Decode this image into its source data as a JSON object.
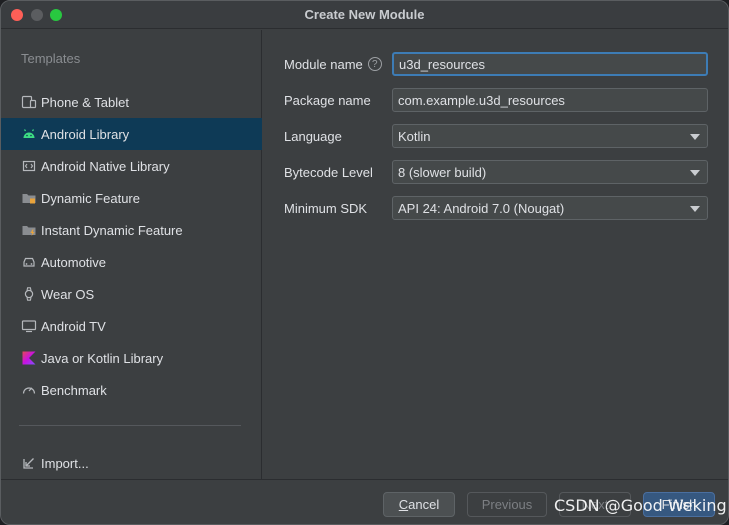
{
  "window": {
    "title": "Create New Module"
  },
  "sidebar": {
    "heading": "Templates",
    "items": [
      {
        "label": "Phone & Tablet",
        "icon": "phone-tablet-icon"
      },
      {
        "label": "Android Library",
        "icon": "android-icon",
        "selected": true
      },
      {
        "label": "Android Native Library",
        "icon": "native-library-icon"
      },
      {
        "label": "Dynamic Feature",
        "icon": "dynamic-feature-folder-icon"
      },
      {
        "label": "Instant Dynamic Feature",
        "icon": "instant-feature-folder-icon"
      },
      {
        "label": "Automotive",
        "icon": "car-icon"
      },
      {
        "label": "Wear OS",
        "icon": "watch-icon"
      },
      {
        "label": "Android TV",
        "icon": "tv-icon"
      },
      {
        "label": "Java or Kotlin Library",
        "icon": "kotlin-icon"
      },
      {
        "label": "Benchmark",
        "icon": "gauge-icon"
      }
    ],
    "import_label": "Import..."
  },
  "form": {
    "module_name": {
      "label": "Module name",
      "value": "u3d_resources",
      "help": "?"
    },
    "package_name": {
      "label": "Package name",
      "value": "com.example.u3d_resources"
    },
    "language": {
      "label": "Language",
      "value": "Kotlin"
    },
    "bytecode_level": {
      "label": "Bytecode Level",
      "value": "8 (slower build)"
    },
    "minimum_sdk": {
      "label": "Minimum SDK",
      "value": "API 24: Android 7.0 (Nougat)"
    }
  },
  "footer": {
    "cancel_mnemonic": "C",
    "cancel_rest": "ancel",
    "previous": "Previous",
    "next": "Next",
    "finish": "Finish"
  },
  "watermark": "CSDN @Good Weking",
  "colors": {
    "selection": "#0e3a56",
    "accent": "#3d7cb5",
    "finish_button": "#365880",
    "android_green": "#3ddc84"
  }
}
